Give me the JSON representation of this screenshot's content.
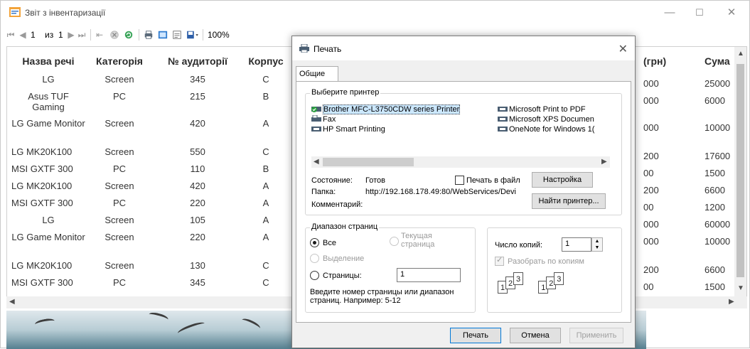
{
  "window": {
    "title": "Звіт з інвентаризації",
    "minimize_glyph": "—",
    "maximize_glyph": "☐",
    "close_glyph": "✕"
  },
  "toolbar": {
    "page_current": "1",
    "page_of_label": "из",
    "page_total": "1",
    "zoom": "100%"
  },
  "report": {
    "headers": [
      "Назва речі",
      "Категорія",
      "№ аудиторії",
      "Корпус"
    ],
    "right_headers": [
      "(грн)",
      "Сума"
    ],
    "rows": [
      {
        "name": "LG",
        "category": "Screen",
        "room": "345",
        "building": "C",
        "price": "000",
        "sum": "25000"
      },
      {
        "name": "Asus TUF Gaming",
        "category": "PC",
        "room": "215",
        "building": "B",
        "price": "000",
        "sum": "6000"
      },
      {
        "name": "LG Game Monitor",
        "category": "Screen",
        "room": "420",
        "building": "A",
        "price": "000",
        "sum": "10000"
      },
      {
        "name": "LG MK20K100",
        "category": "Screen",
        "room": "550",
        "building": "C",
        "price": "200",
        "sum": "17600"
      },
      {
        "name": "MSI GXTF 300",
        "category": "PC",
        "room": "110",
        "building": "B",
        "price": "00",
        "sum": "1500"
      },
      {
        "name": "LG MK20K100",
        "category": "Screen",
        "room": "420",
        "building": "A",
        "price": "200",
        "sum": "6600"
      },
      {
        "name": "MSI GXTF 300",
        "category": "PC",
        "room": "220",
        "building": "A",
        "price": "00",
        "sum": "1200"
      },
      {
        "name": "LG",
        "category": "Screen",
        "room": "105",
        "building": "A",
        "price": "000",
        "sum": "60000"
      },
      {
        "name": "LG Game Monitor",
        "category": "Screen",
        "room": "220",
        "building": "A",
        "price": "000",
        "sum": "10000"
      },
      {
        "name": "LG MK20K100",
        "category": "Screen",
        "room": "130",
        "building": "C",
        "price": "200",
        "sum": "6600"
      },
      {
        "name": "MSI GXTF 300",
        "category": "PC",
        "room": "345",
        "building": "C",
        "price": "00",
        "sum": "1500"
      }
    ]
  },
  "print_dialog": {
    "title": "Печать",
    "tab": "Общие",
    "printer_group": "Выберите принтер",
    "printers": [
      {
        "name": "Brother MFC-L3750CDW series Printer",
        "selected": true,
        "icon": "printer-icon-default"
      },
      {
        "name": "Fax",
        "selected": false,
        "icon": "fax-icon"
      },
      {
        "name": "HP Smart Printing",
        "selected": false,
        "icon": "printer-icon"
      },
      {
        "name": "Microsoft Print to PDF",
        "selected": false,
        "icon": "printer-icon"
      },
      {
        "name": "Microsoft XPS Documen",
        "selected": false,
        "icon": "printer-icon"
      },
      {
        "name": "OneNote for Windows 1(",
        "selected": false,
        "icon": "printer-icon"
      }
    ],
    "status_label": "Состояние:",
    "status_value": "Готов",
    "folder_label": "Папка:",
    "folder_value": "http://192.168.178.49:80/WebServices/Devi",
    "comment_label": "Комментарий:",
    "print_to_file": "Печать в файл",
    "settings_button": "Настройка",
    "find_printer_button": "Найти принтер...",
    "range_group": "Диапазон страниц",
    "range_all": "Все",
    "range_selection": "Выделение",
    "range_current": "Текущая страница",
    "range_pages": "Страницы:",
    "range_pages_value": "1",
    "range_hint": "Введите номер страницы или диапазон страниц.  Например: 5-12",
    "copies_label": "Число копий:",
    "copies_value": "1",
    "collate": "Разобрать по копиям",
    "print_button": "Печать",
    "cancel_button": "Отмена",
    "apply_button": "Применить"
  }
}
